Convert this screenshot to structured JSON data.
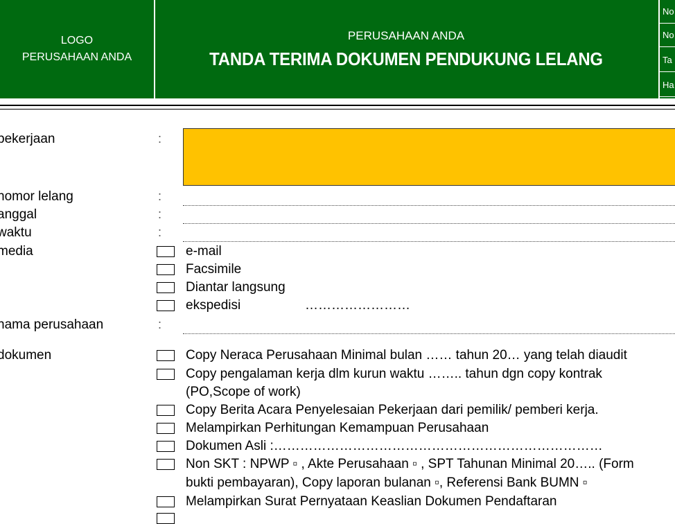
{
  "header": {
    "logo_line1": "LOGO",
    "logo_line2": "PERUSAHAAN ANDA",
    "company": "PERUSAHAAN ANDA",
    "title": "TANDA TERIMA DOKUMEN PENDUKUNG LELANG",
    "meta": [
      "No",
      "No",
      "Ta",
      "Ha"
    ]
  },
  "fields": {
    "pekerjaan": "pekerjaan",
    "nomor_lelang": "nomor lelang",
    "tanggal": "anggal",
    "waktu": "waktu",
    "media": "media",
    "nama_perusahaan": "nama perusahaan",
    "dokumen": "dokumen",
    "colon": ":"
  },
  "media_options": [
    "e-mail",
    "Facsimile",
    "Diantar langsung",
    "ekspedisi"
  ],
  "ekspedisi_dots": "……………………",
  "documents": [
    "Copy Neraca Perusahaan Minimal bulan …… tahun 20…  yang telah diaudit",
    "Copy pengalaman kerja dlm kurun waktu …….. tahun dgn copy kontrak",
    "(PO,Scope of work)",
    "Copy Berita Acara Penyelesaian Pekerjaan dari pemilik/ pemberi kerja.",
    "Melampirkan Perhitungan Kemampuan Perusahaan",
    "Dokumen Asli :…………………………………………………………………",
    "Non SKT : NPWP ▫ , Akte Perusahaan ▫ , SPT Tahunan Minimal 20…..  (Form",
    "bukti pembayaran), Copy laporan bulanan ▫, Referensi Bank BUMN ▫",
    "Melampirkan Surat Pernyataan Keaslian Dokumen Pendaftaran"
  ]
}
